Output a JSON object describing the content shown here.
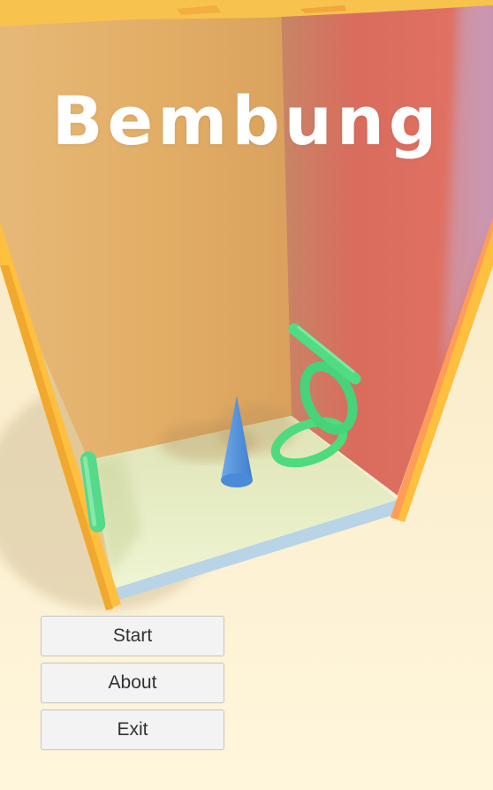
{
  "game": {
    "title": "Bembung"
  },
  "menu": {
    "buttons": [
      {
        "label": "Start"
      },
      {
        "label": "About"
      },
      {
        "label": "Exit"
      }
    ]
  },
  "colors": {
    "background": "#fdf3d6",
    "back_wall": "#e2b06a",
    "right_wall": "#d9665a",
    "frame": "#ffbf3f",
    "floor": "#e4ecc6",
    "rings": "#4ddb7e",
    "cone": "#4f93da",
    "button_bg": "#f3f3f3",
    "button_text": "#323232"
  }
}
